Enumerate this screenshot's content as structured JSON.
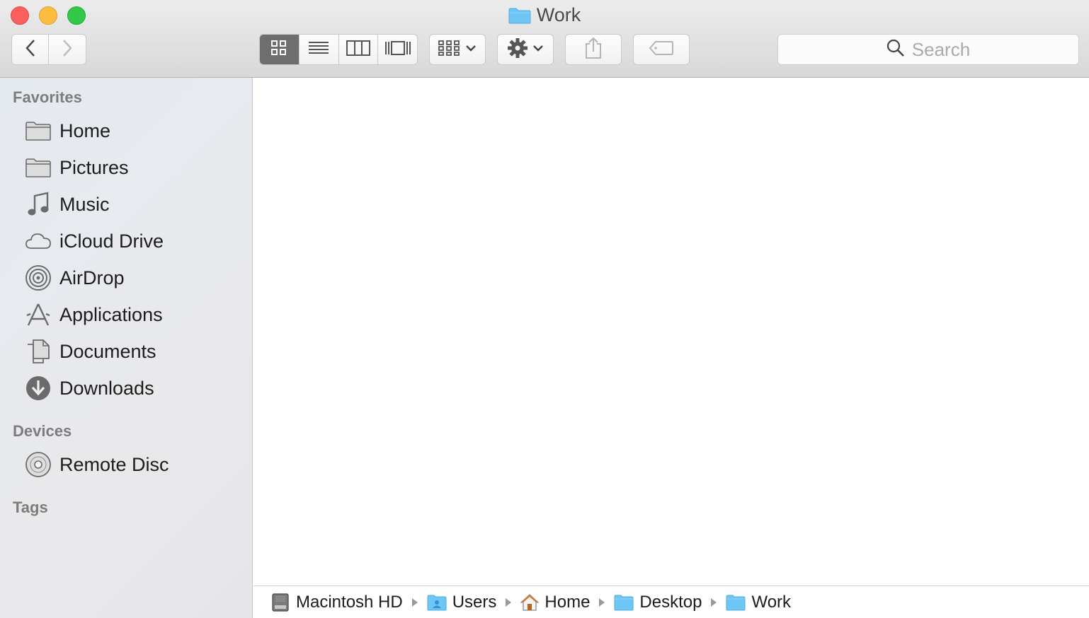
{
  "window": {
    "title": "Work"
  },
  "toolbar": {
    "back_icon": "chevron-left-icon",
    "forward_icon": "chevron-right-icon",
    "view_modes": [
      "icon-view",
      "list-view",
      "column-view",
      "cover-flow-view"
    ],
    "active_view": "icon-view",
    "search_placeholder": "Search"
  },
  "sidebar": {
    "favorites_header": "Favorites",
    "favorites": [
      {
        "label": "Home",
        "icon": "folder-icon"
      },
      {
        "label": "Pictures",
        "icon": "folder-icon"
      },
      {
        "label": "Music",
        "icon": "music-note-icon"
      },
      {
        "label": "iCloud Drive",
        "icon": "cloud-icon"
      },
      {
        "label": "AirDrop",
        "icon": "airdrop-icon"
      },
      {
        "label": "Applications",
        "icon": "applications-icon"
      },
      {
        "label": "Documents",
        "icon": "documents-icon"
      },
      {
        "label": "Downloads",
        "icon": "download-icon"
      }
    ],
    "devices_header": "Devices",
    "devices": [
      {
        "label": "Remote Disc",
        "icon": "disc-icon"
      }
    ],
    "tags_header": "Tags"
  },
  "pathbar": {
    "items": [
      {
        "label": "Macintosh HD",
        "icon": "hard-drive-icon"
      },
      {
        "label": "Users",
        "icon": "users-folder-icon"
      },
      {
        "label": "Home",
        "icon": "home-icon"
      },
      {
        "label": "Desktop",
        "icon": "folder-icon"
      },
      {
        "label": "Work",
        "icon": "folder-icon"
      }
    ]
  },
  "colors": {
    "folder_blue": "#6ec6f5",
    "close": "#fc605c",
    "minimize": "#fdbc40",
    "zoom": "#34c84a",
    "active_segment": "#6e6e6e"
  }
}
